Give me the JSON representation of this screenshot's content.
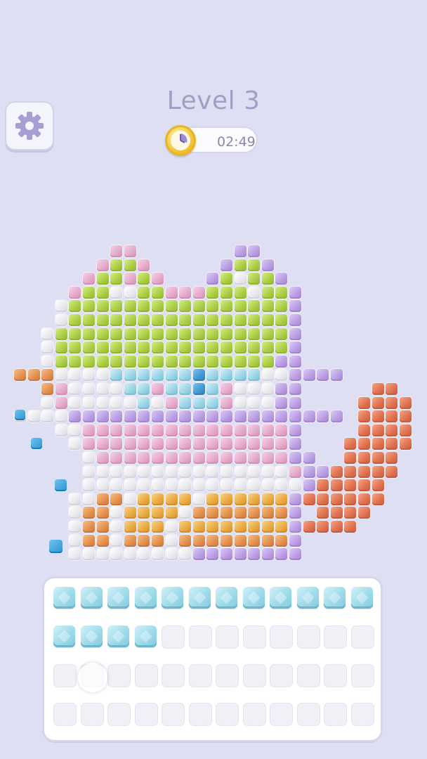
{
  "header": {
    "level_label": "Level 3",
    "timer_text": "02:49",
    "settings_icon": "gear-icon",
    "timer_icon": "clock-icon"
  },
  "colors": {
    "background": "#dfdff4",
    "lime": "#bddc5c",
    "lavender": "#c7b1ea",
    "pink": "#ecbfd9",
    "white": "#f4f4f6",
    "blue": "#a9deed",
    "orange": "#eba05e",
    "coral": "#e9815f",
    "gold": "#f0ba52",
    "dark_blue": "#4aa6dc"
  },
  "tray": {
    "rows": 4,
    "columns": 12,
    "filled_tiles": 16,
    "tile_color": "blue"
  }
}
